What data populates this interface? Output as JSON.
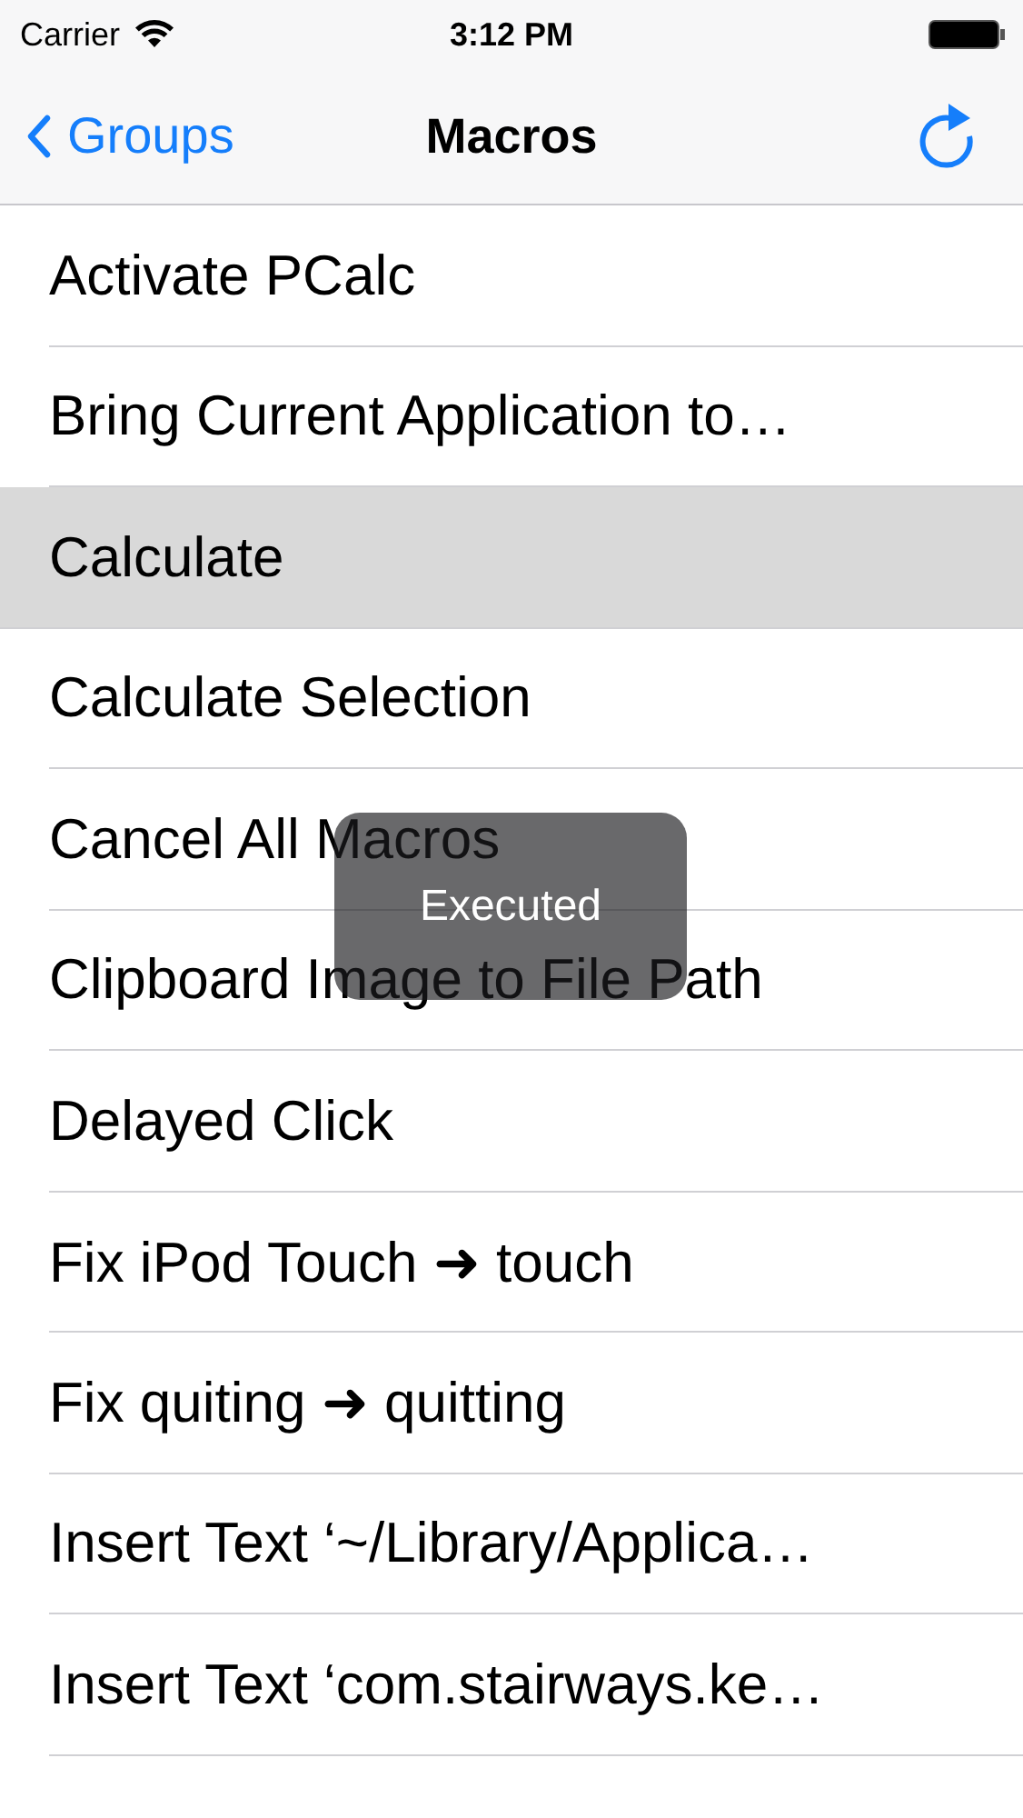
{
  "status_bar": {
    "carrier": "Carrier",
    "time": "3:12 PM"
  },
  "nav": {
    "back": "Groups",
    "title": "Macros"
  },
  "rows": [
    {
      "label": "Activate PCalc",
      "selected": false
    },
    {
      "label": "Bring Current Application to…",
      "selected": false
    },
    {
      "label": "Calculate",
      "selected": true
    },
    {
      "label": "Calculate Selection",
      "selected": false
    },
    {
      "label": "Cancel All Macros",
      "selected": false
    },
    {
      "label": "Clipboard Image to File Path",
      "selected": false
    },
    {
      "label": "Delayed Click",
      "selected": false
    },
    {
      "label": "Fix iPod Touch ➜ touch",
      "selected": false
    },
    {
      "label": "Fix quiting ➜ quitting",
      "selected": false
    },
    {
      "label": "Insert Text ‘~/Library/Applica…",
      "selected": false
    },
    {
      "label": "Insert Text ‘com.stairways.ke…",
      "selected": false
    }
  ],
  "toast": {
    "text": "Executed"
  }
}
